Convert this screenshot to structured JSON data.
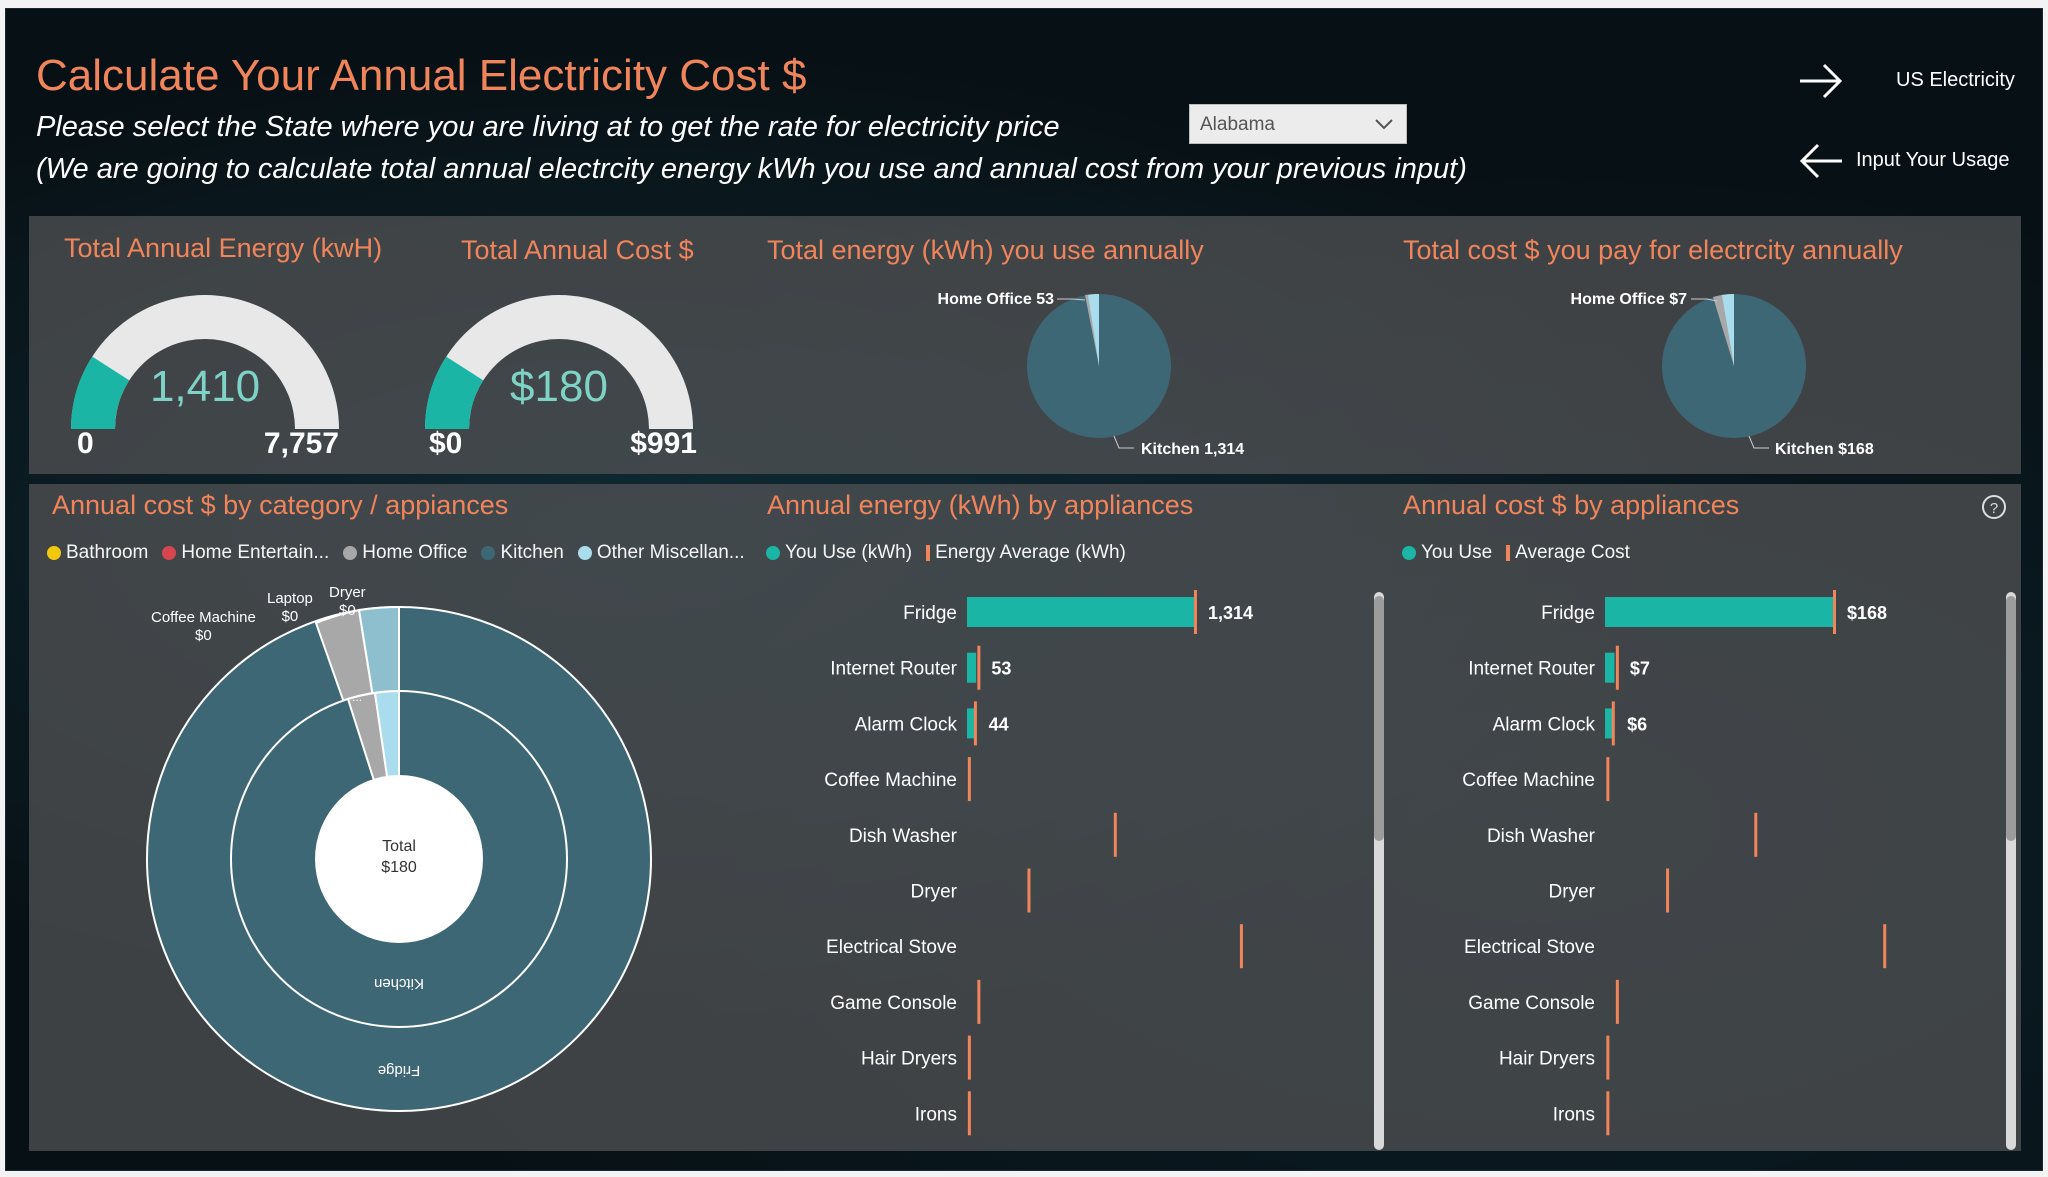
{
  "header": {
    "title": "Calculate Your Annual Electricity Cost $",
    "instruction_1": "Please select the State where you are living at to get the rate for electricity price",
    "instruction_2": "(We are going to calculate total annual electrcity energy kWh you use and annual cost from your previous input)",
    "state_selected": "Alabama",
    "nav_forward_label": "US Electricity",
    "nav_back_label": "Input Your Usage"
  },
  "colors": {
    "accent_orange": "#f0845a",
    "teal": "#1bb5a5",
    "pie_main": "#3e6776",
    "gauge_bg": "#e8e8e8"
  },
  "gauge_energy": {
    "title": "Total Annual Energy (kwH)",
    "value": 1410,
    "value_label": "1,410",
    "min": 0,
    "max": 7757,
    "min_label": "0",
    "max_label": "7,757"
  },
  "gauge_cost": {
    "title": "Total Annual Cost $",
    "value": 180,
    "value_label": "$180",
    "min": 0,
    "max": 991,
    "min_label": "$0",
    "max_label": "$991"
  },
  "pie_energy": {
    "title": "Total energy (kWh) you use annually",
    "label_top": "Home Office 53",
    "label_bottom": "Kitchen 1,314"
  },
  "pie_cost": {
    "title": "Total cost $ you pay for electrcity annually",
    "label_top": "Home Office $7",
    "label_bottom": "Kitchen $168"
  },
  "donut": {
    "title": "Annual cost $ by category / appiances",
    "legend": [
      {
        "label": "Bathroom",
        "color": "#f2c80f"
      },
      {
        "label": "Home Entertain...",
        "color": "#d64550"
      },
      {
        "label": "Home Office",
        "color": "#a8a8a8"
      },
      {
        "label": "Kitchen",
        "color": "#3e6776"
      },
      {
        "label": "Other Miscellan...",
        "color": "#a9dced"
      }
    ],
    "center_label": "Total",
    "center_value": "$180",
    "inner_label": "Kitchen",
    "outer_label": "Fridge",
    "ellipsis": "...",
    "callouts": [
      {
        "name": "Coffee Machine",
        "value": "$0"
      },
      {
        "name": "Laptop",
        "value": "$0"
      },
      {
        "name": "Dryer",
        "value": "$0"
      }
    ]
  },
  "chart_data": [
    {
      "type": "bar",
      "title": "Annual energy (kWh) by appliances",
      "orientation": "horizontal",
      "series": [
        {
          "name": "You Use (kWh)",
          "color": "#1bb5a5",
          "values": [
            1314,
            53,
            44,
            0,
            0,
            0,
            0,
            0,
            0,
            0
          ]
        },
        {
          "name": "Energy Average (kWh)",
          "color": "#f0845a",
          "values": [
            1314,
            60,
            40,
            5,
            850,
            350,
            1580,
            60,
            5,
            5
          ]
        }
      ],
      "categories": [
        "Fridge",
        "Internet Router",
        "Alarm Clock",
        "Coffee Machine",
        "Dish Washer",
        "Dryer",
        "Electrical Stove",
        "Game Console",
        "Hair Dryers",
        "Irons"
      ],
      "data_labels": [
        "1,314",
        "53",
        "44",
        "",
        "",
        "",
        "",
        "",
        "",
        ""
      ],
      "xlim": [
        0,
        2200
      ]
    },
    {
      "type": "bar",
      "title": "Annual cost $ by appliances",
      "orientation": "horizontal",
      "series": [
        {
          "name": "You Use",
          "color": "#1bb5a5",
          "values": [
            168,
            7,
            6,
            0,
            0,
            0,
            0,
            0,
            0,
            0
          ]
        },
        {
          "name": "Average Cost",
          "color": "#f0845a",
          "values": [
            168,
            8,
            5,
            1,
            110,
            45,
            205,
            8,
            1,
            1
          ]
        }
      ],
      "categories": [
        "Fridge",
        "Internet Router",
        "Alarm Clock",
        "Coffee Machine",
        "Dish Washer",
        "Dryer",
        "Electrical Stove",
        "Game Console",
        "Hair Dryers",
        "Irons"
      ],
      "data_labels": [
        "$168",
        "$7",
        "$6",
        "",
        "",
        "",
        "",
        "",
        "",
        ""
      ],
      "xlim": [
        0,
        280
      ]
    }
  ]
}
